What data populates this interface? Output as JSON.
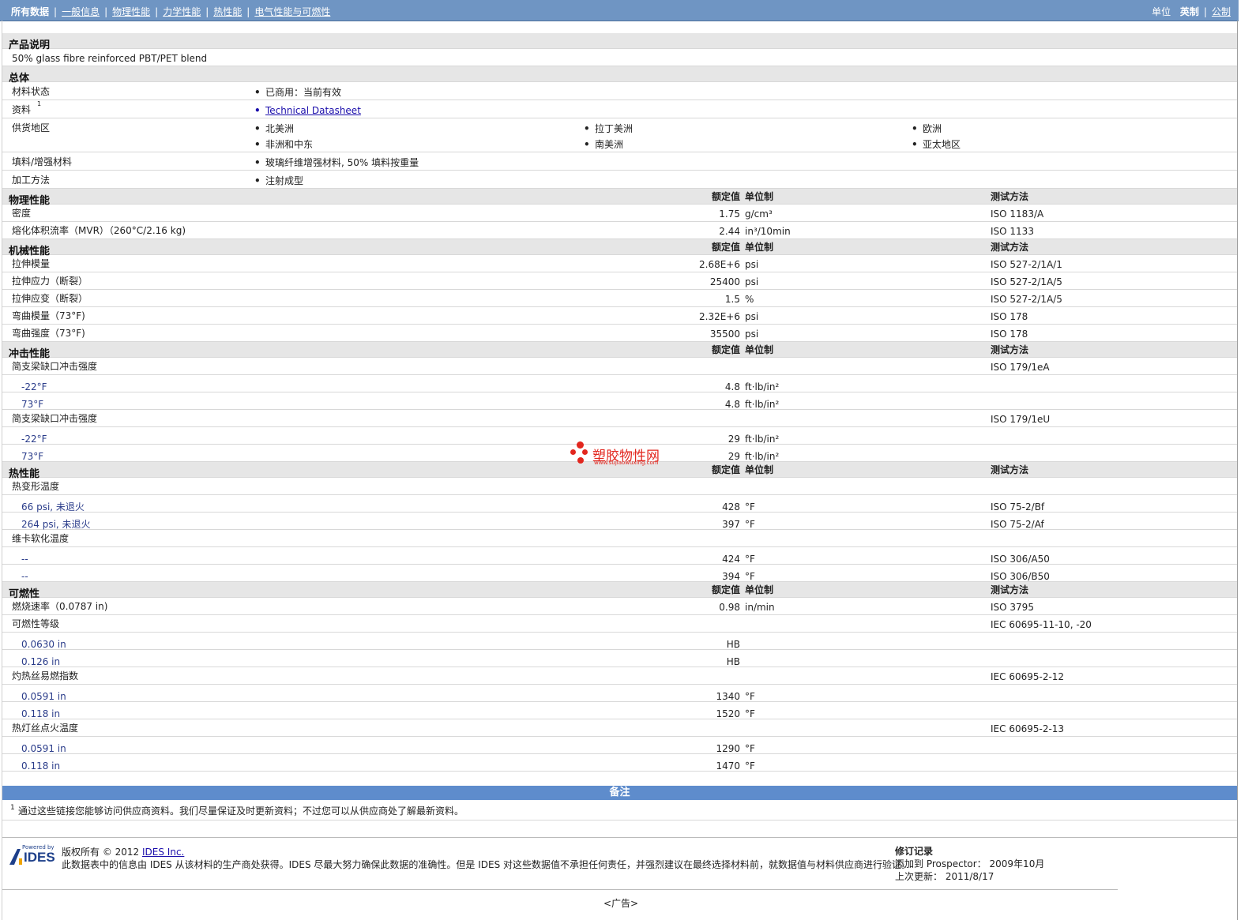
{
  "nav": {
    "tabs": [
      "所有数据",
      "一般信息",
      "物理性能",
      "力学性能",
      "热性能",
      "电气性能与可燃性"
    ],
    "units_label": "单位",
    "units": [
      "英制",
      "公制"
    ]
  },
  "product": {
    "section_title": "产品说明",
    "description": "50% glass fibre reinforced PBT/PET blend"
  },
  "general": {
    "section_title": "总体",
    "rows": [
      {
        "label": "材料状态",
        "values": [
          "已商用：当前有效"
        ]
      },
      {
        "label": "资料",
        "sup": "1",
        "values": [
          "Technical Datasheet"
        ]
      },
      {
        "label": "供货地区",
        "values": [
          "北美洲",
          "拉丁美洲",
          "欧洲",
          "非洲和中东",
          "南美洲",
          "亚太地区"
        ]
      },
      {
        "label": "填料/增强材料",
        "values": [
          "玻璃纤维增强材料, 50% 填料按重量"
        ]
      },
      {
        "label": "加工方法",
        "values": [
          "注射成型"
        ]
      }
    ]
  },
  "headers": {
    "nominal": "额定值",
    "unit": "单位制",
    "test": "测试方法"
  },
  "physical": {
    "section_title": "物理性能",
    "rows": [
      {
        "label": "密度",
        "value": "1.75",
        "unit": "g/cm³",
        "test": "ISO 1183/A"
      },
      {
        "label": "熔化体积流率（MVR）（260°C/2.16 kg)",
        "value": "2.44",
        "unit": "in³/10min",
        "test": "ISO 1133"
      }
    ]
  },
  "mechanical": {
    "section_title": "机械性能",
    "rows": [
      {
        "label": "拉伸模量",
        "value": "2.68E+6",
        "unit": "psi",
        "test": "ISO 527-2/1A/1"
      },
      {
        "label": "拉伸应力（断裂）",
        "value": "25400",
        "unit": "psi",
        "test": "ISO 527-2/1A/5"
      },
      {
        "label": "拉伸应变（断裂）",
        "value": "1.5",
        "unit": "%",
        "test": "ISO 527-2/1A/5"
      },
      {
        "label": "弯曲模量（73°F)",
        "value": "2.32E+6",
        "unit": "psi",
        "test": "ISO 178"
      },
      {
        "label": "弯曲强度（73°F)",
        "value": "35500",
        "unit": "psi",
        "test": "ISO 178"
      }
    ]
  },
  "impact": {
    "section_title": "冲击性能",
    "rows": [
      {
        "label": "简支梁缺口冲击强度",
        "test": "ISO 179/1eA"
      },
      {
        "sub": "-22°F",
        "value": "4.8",
        "unit": "ft·lb/in²"
      },
      {
        "sub": "73°F",
        "value": "4.8",
        "unit": "ft·lb/in²"
      },
      {
        "label": "简支梁缺口冲击强度",
        "test": "ISO 179/1eU"
      },
      {
        "sub": "-22°F",
        "value": "29",
        "unit": "ft·lb/in²"
      },
      {
        "sub": "73°F",
        "value": "29",
        "unit": "ft·lb/in²"
      }
    ]
  },
  "thermal": {
    "section_title": "热性能",
    "rows": [
      {
        "label": "热变形温度"
      },
      {
        "sub": "66 psi, 未退火",
        "value": "428",
        "unit": "°F",
        "test": "ISO 75-2/Bf"
      },
      {
        "sub": "264 psi, 未退火",
        "value": "397",
        "unit": "°F",
        "test": "ISO 75-2/Af"
      },
      {
        "label": "维卡软化温度"
      },
      {
        "sub": "--",
        "value": "424",
        "unit": "°F",
        "test": "ISO 306/A50"
      },
      {
        "sub": "--",
        "value": "394",
        "unit": "°F",
        "test": "ISO 306/B50"
      }
    ]
  },
  "flammability": {
    "section_title": "可燃性",
    "rows": [
      {
        "label": "燃烧速率（0.0787 in)",
        "value": "0.98",
        "unit": "in/min",
        "test": "ISO 3795"
      },
      {
        "label": "可燃性等级",
        "test": "IEC 60695-11-10, -20"
      },
      {
        "sub": "0.0630 in",
        "value": "HB"
      },
      {
        "sub": "0.126 in",
        "value": "HB"
      },
      {
        "label": "灼热丝易燃指数",
        "test": "IEC 60695-2-12"
      },
      {
        "sub": "0.0591 in",
        "value": "1340",
        "unit": "°F"
      },
      {
        "sub": "0.118 in",
        "value": "1520",
        "unit": "°F"
      },
      {
        "label": "热灯丝点火温度",
        "test": "IEC 60695-2-13"
      },
      {
        "sub": "0.0591 in",
        "value": "1290",
        "unit": "°F"
      },
      {
        "sub": "0.118 in",
        "value": "1470",
        "unit": "°F"
      }
    ]
  },
  "notes": {
    "title": "备注",
    "sup": "1",
    "text": "通过这些链接您能够访问供应商资料。我们尽量保证及时更新资料；不过您可以从供应商处了解最新资料。"
  },
  "footer": {
    "logo_small": "Powered by",
    "logo_text": "IDES",
    "copyright_prefix": "版权所有 © 2012",
    "copyright_link": "IDES Inc.",
    "disclaimer": "此数据表中的信息由 IDES 从该材料的生产商处获得。IDES 尽最大努力确保此数据的准确性。但是 IDES 对这些数据值不承担任何责任，并强烈建议在最终选择材料前，就数据值与材料供应商进行验证。",
    "revision_title": "修订记录",
    "added_label": "添加到 Prospector：",
    "added_value": "2009年10月",
    "updated_label": "上次更新：",
    "updated_value": "2011/8/17",
    "ad": "<广告>"
  },
  "watermark": {
    "text": "塑胶物性网",
    "url": "www.sujiaowuxing.com",
    "color": "#e2261e"
  }
}
